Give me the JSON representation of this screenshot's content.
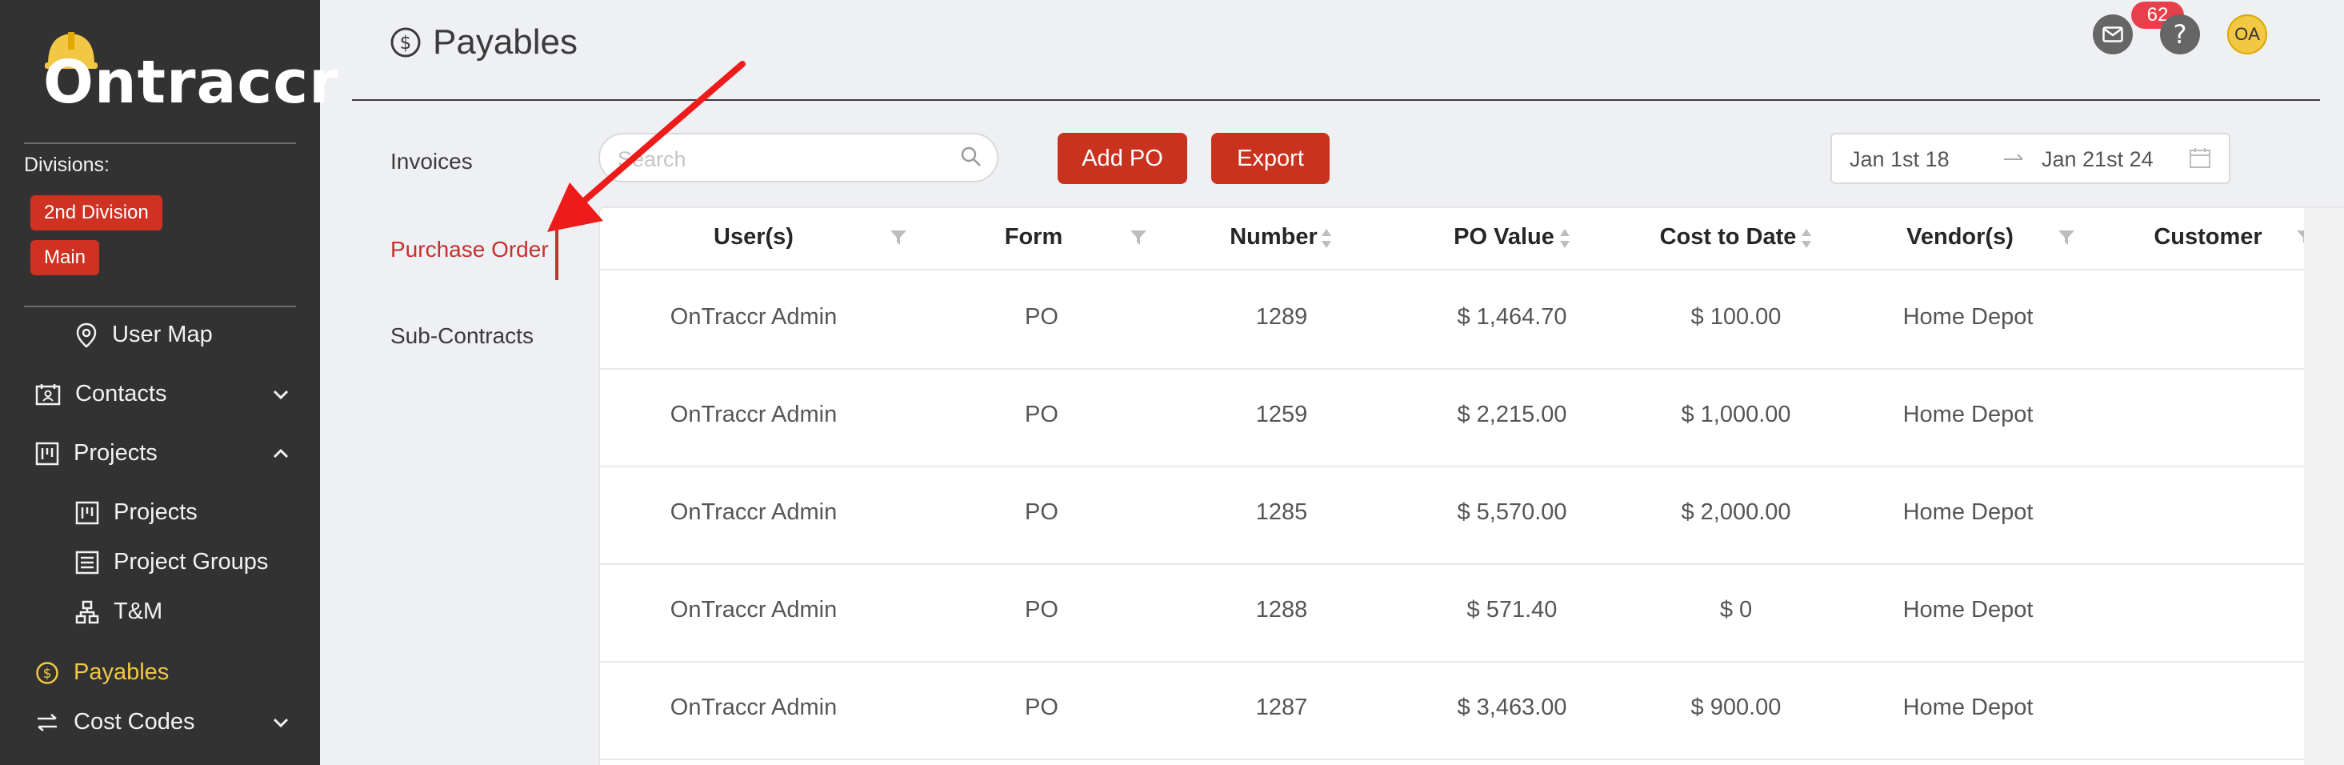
{
  "sidebar": {
    "logo_text": "Ontraccr",
    "divisions_label": "Divisions:",
    "divisions": [
      "2nd Division",
      "Main"
    ],
    "items": [
      {
        "label": "User Map",
        "icon": "map-pin-icon"
      },
      {
        "label": "Contacts",
        "icon": "contacts-icon",
        "chevron": "chevron-down-icon"
      },
      {
        "label": "Projects",
        "icon": "projects-icon",
        "chevron": "chevron-up-icon"
      },
      {
        "label": "Projects",
        "icon": "projects-icon"
      },
      {
        "label": "Project Groups",
        "icon": "project-groups-icon"
      },
      {
        "label": "T&M",
        "icon": "hierarchy-icon"
      },
      {
        "label": "Payables",
        "icon": "dollar-circle-icon",
        "active": true
      },
      {
        "label": "Cost Codes",
        "icon": "swap-icon",
        "chevron": "chevron-down-icon"
      }
    ]
  },
  "header": {
    "title": "Payables",
    "notification_count": "62",
    "avatar_initials": "OA"
  },
  "subnav": [
    "Invoices",
    "Purchase Order",
    "Sub-Contracts"
  ],
  "toolbar": {
    "search_placeholder": "Search",
    "add_po_label": "Add PO",
    "export_label": "Export",
    "date_start": "Jan 1st 18",
    "date_end": "Jan 21st 24"
  },
  "table": {
    "columns": [
      "User(s)",
      "Form",
      "Number",
      "PO Value",
      "Cost to Date",
      "Vendor(s)",
      "Customer"
    ],
    "rows": [
      [
        "OnTraccr Admin",
        "PO",
        "1289",
        "$ 1,464.70",
        "$ 100.00",
        "Home Depot",
        ""
      ],
      [
        "OnTraccr Admin",
        "PO",
        "1259",
        "$ 2,215.00",
        "$ 1,000.00",
        "Home Depot",
        ""
      ],
      [
        "OnTraccr Admin",
        "PO",
        "1285",
        "$ 5,570.00",
        "$ 2,000.00",
        "Home Depot",
        ""
      ],
      [
        "OnTraccr Admin",
        "PO",
        "1288",
        "$ 571.40",
        "$ 0",
        "Home Depot",
        ""
      ],
      [
        "OnTraccr Admin",
        "PO",
        "1287",
        "$ 3,463.00",
        "$ 900.00",
        "Home Depot",
        ""
      ]
    ]
  },
  "colors": {
    "sidebar_bg": "#323232",
    "accent_red": "#c8321f",
    "active_yellow": "#f2c744",
    "annotation_arrow": "#ee1b1b"
  }
}
